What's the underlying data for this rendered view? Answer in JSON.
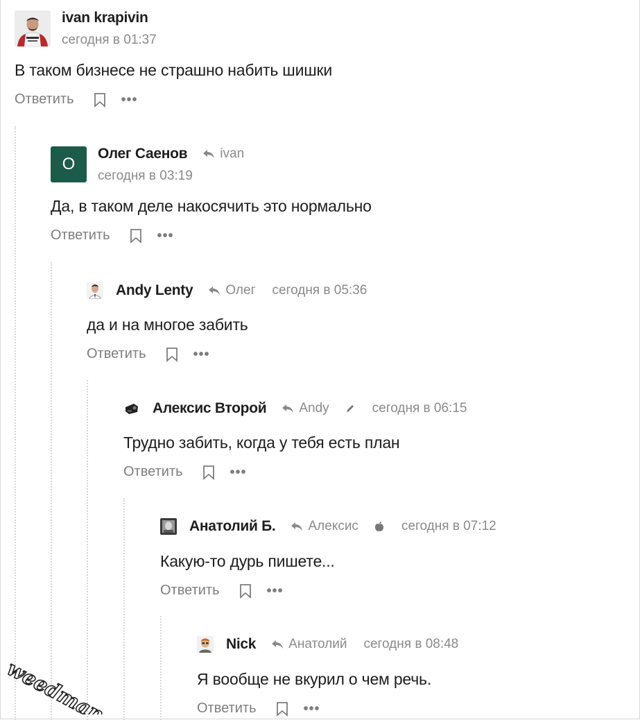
{
  "comments": [
    {
      "author": "ivan krapivin",
      "time": "сегодня в 01:37",
      "text": "В таком бизнесе не страшно набить шишки",
      "reply_label": "Ответить",
      "more": "•••"
    },
    {
      "author": "Олег Саенов",
      "avatar_letter": "О",
      "reply_to": "ivan",
      "time": "сегодня в 03:19",
      "text": "Да, в таком деле накосячить это нормально",
      "reply_label": "Ответить",
      "more": "•••"
    },
    {
      "author": "Andy Lenty",
      "reply_to": "Олег",
      "time": "сегодня в 05:36",
      "text": "да и на многое забить",
      "reply_label": "Ответить",
      "more": "•••"
    },
    {
      "author": "Алексис Второй",
      "reply_to": "Andy",
      "client_icon": "pencil-icon",
      "time": "сегодня в 06:15",
      "text": "Трудно забить, когда у тебя есть план",
      "reply_label": "Ответить",
      "more": "•••"
    },
    {
      "author": "Анатолий Б.",
      "reply_to": "Алексис",
      "client_icon": "apple-icon",
      "time": "сегодня в 07:12",
      "text": "Какую-то дурь пишете...",
      "reply_label": "Ответить",
      "more": "•••"
    },
    {
      "author": "Nick",
      "reply_to": "Анатолий",
      "time": "сегодня в 08:48",
      "text": "Я вообще не вкурил о чем речь.",
      "reply_label": "Ответить",
      "more": "•••"
    }
  ],
  "watermark": "weedman",
  "colors": {
    "avatar_letter_bg": "#1c5a4a",
    "meta_text": "#8a8a8a",
    "thread_line": "#d6d6d6"
  }
}
